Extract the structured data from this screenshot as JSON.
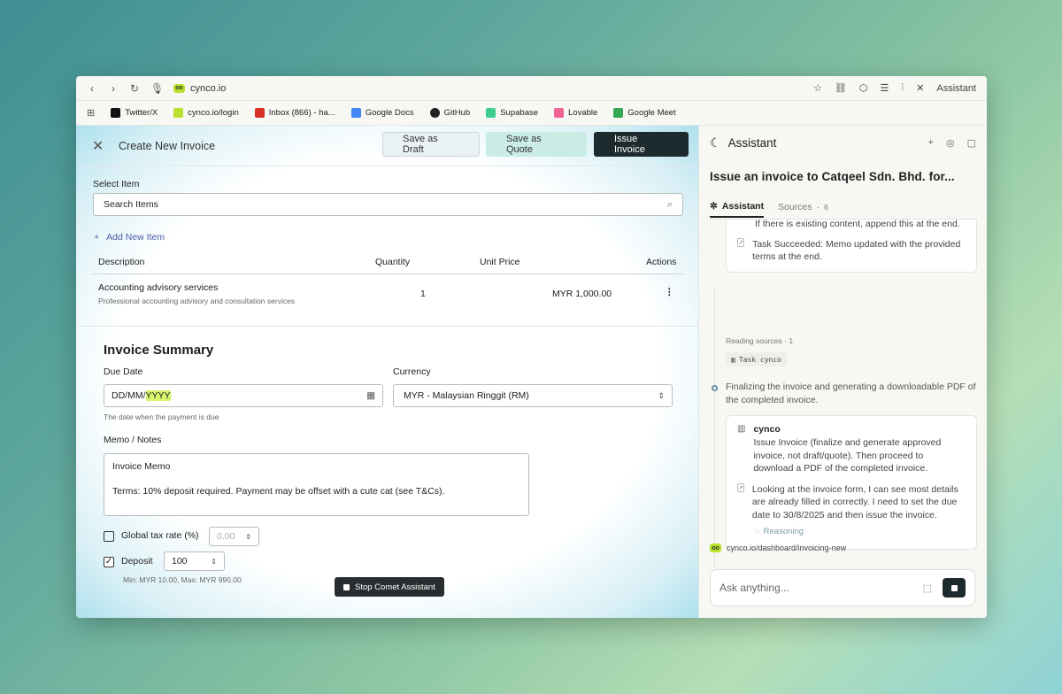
{
  "browser": {
    "url": "cynco.io",
    "assistant_label": "Assistant",
    "bookmarks": [
      {
        "label": "Twitter/X",
        "color": "#111111"
      },
      {
        "label": "cynco.io/login",
        "color": "#b9e12e"
      },
      {
        "label": "Inbox (866) - ha...",
        "color": "#d93025"
      },
      {
        "label": "Google Docs",
        "color": "#4285f4"
      },
      {
        "label": "GitHub",
        "color": "#222222"
      },
      {
        "label": "Supabase",
        "color": "#3ecf8e"
      },
      {
        "label": "Lovable",
        "color": "#f06292"
      },
      {
        "label": "Google Meet",
        "color": "#34a853"
      }
    ]
  },
  "invoice": {
    "title": "Create New Invoice",
    "save_draft": "Save as Draft",
    "save_quote": "Save as Quote",
    "issue": "Issue Invoice",
    "select_item_label": "Select Item",
    "search_placeholder": "Search Items",
    "add_item": "Add New Item",
    "table": {
      "headers": [
        "Description",
        "Quantity",
        "Unit Price",
        "Actions"
      ],
      "rows": [
        {
          "description": "Accounting advisory services",
          "subtitle": "Professional accounting advisory and consultation services",
          "quantity": "1",
          "unit_price": "MYR 1,000.00"
        }
      ]
    },
    "summary_title": "Invoice Summary",
    "due_date_label": "Due Date",
    "due_date_dd": "DD",
    "due_date_mm": "MM",
    "due_date_yyyy": "YYYY",
    "due_date_hint": "The date when the payment is due",
    "currency_label": "Currency",
    "currency_value": "MYR - Malaysian Ringgit (RM)",
    "memo_label": "Memo / Notes",
    "memo_line1": "Invoice Memo",
    "memo_line2": "Terms: 10% deposit required. Payment may be offset with a cute cat (see T&Cs).",
    "tax_label": "Global tax rate (%)",
    "tax_placeholder": "0.00",
    "deposit_label": "Deposit",
    "deposit_value": "100",
    "deposit_hint": "Min: MYR 10.00, Max: MYR 990.00",
    "stop_button": "Stop Comet Assistant"
  },
  "assistant": {
    "title": "Assistant",
    "question": "Issue an invoice to Catqeel Sdn. Bhd. for...",
    "tab_assistant": "Assistant",
    "tab_sources": "Sources",
    "sources_count": "6",
    "card1_line0": "If there is existing content, append this at the end.",
    "card1_task": "Task Succeeded: Memo updated with the provided terms at the end.",
    "reading_sources": "Reading sources · 1",
    "task_chip": "Task cynco",
    "finalizing": "Finalizing the invoice and generating a downloadable PDF of the completed invoice.",
    "card2_title": "cynco",
    "card2_text": "Issue Invoice (finalize and generate approved invoice, not draft/quote). Then proceed to download a PDF of the completed invoice.",
    "card2_thought": "Looking at the invoice form, I can see most details are already filled in correctly. I need to set the due date to 30/8/2025 and then issue the invoice.",
    "reasoning": "Reasoning",
    "context_url": "cynco.io/dashboard/invoicing-new",
    "ask_placeholder": "Ask anything..."
  }
}
